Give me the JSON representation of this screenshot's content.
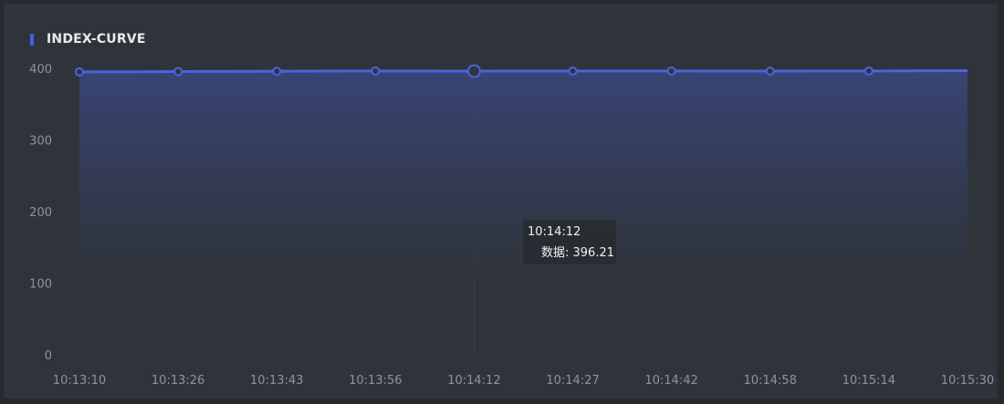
{
  "chart_data": {
    "type": "area",
    "title": "INDEX-CURVE",
    "x": [
      "10:13:10",
      "10:13:26",
      "10:13:43",
      "10:13:56",
      "10:14:12",
      "10:14:27",
      "10:14:42",
      "10:14:58",
      "10:15:14",
      "10:15:30"
    ],
    "series": [
      {
        "values": [
          395.0,
          395.6,
          396.0,
          396.4,
          396.21,
          396.3,
          396.3,
          396.2,
          396.4,
          396.8
        ]
      }
    ],
    "y_ticks": [
      "0",
      "100",
      "200",
      "300",
      "400"
    ],
    "ylim": [
      0,
      400
    ],
    "grid": false,
    "line_color": "#4a63dd",
    "highlighted_index": 4,
    "tooltip": {
      "time": "10:14:12",
      "label": "数据: 396.21"
    }
  }
}
